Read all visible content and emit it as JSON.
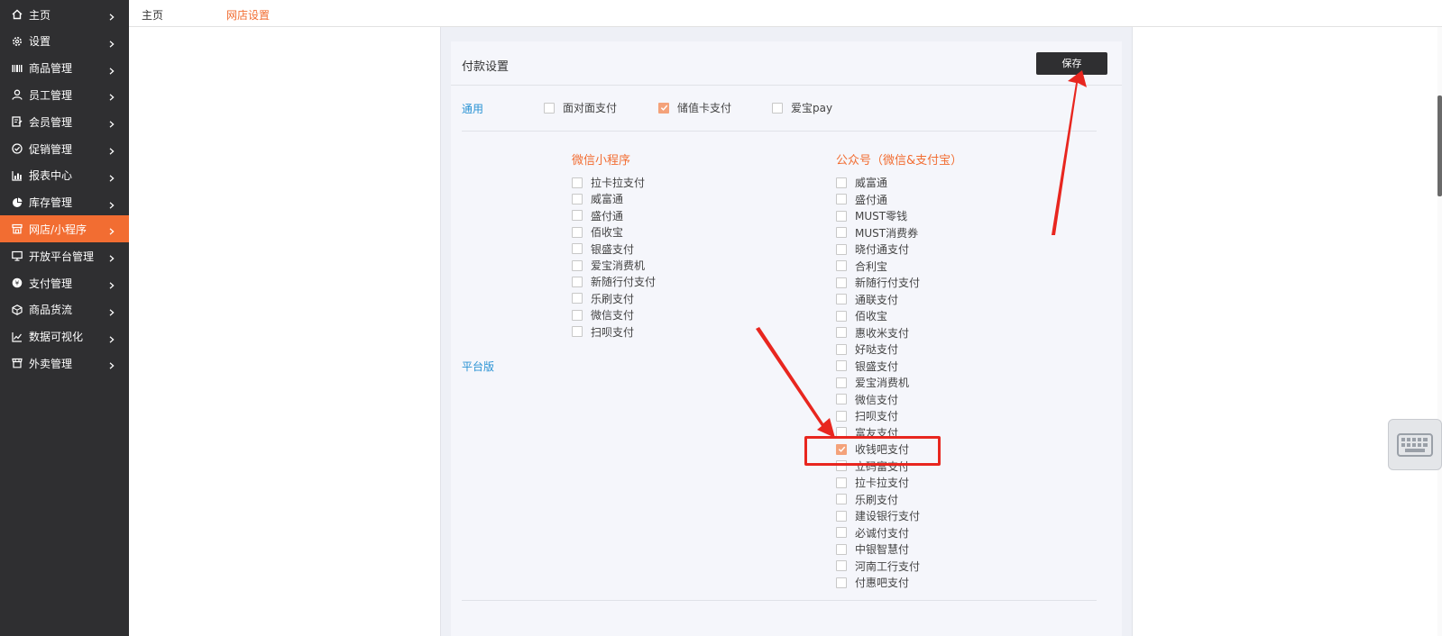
{
  "sidebar": {
    "items": [
      {
        "label": "主页",
        "icon": "home-icon"
      },
      {
        "label": "设置",
        "icon": "gear-icon"
      },
      {
        "label": "商品管理",
        "icon": "barcode-icon"
      },
      {
        "label": "员工管理",
        "icon": "user-icon"
      },
      {
        "label": "会员管理",
        "icon": "member-card-icon"
      },
      {
        "label": "促销管理",
        "icon": "check-circle-icon"
      },
      {
        "label": "报表中心",
        "icon": "bar-chart-icon"
      },
      {
        "label": "库存管理",
        "icon": "pie-chart-icon"
      },
      {
        "label": "网店/小程序",
        "icon": "store-icon"
      },
      {
        "label": "开放平台管理",
        "icon": "monitor-icon"
      },
      {
        "label": "支付管理",
        "icon": "coin-icon"
      },
      {
        "label": "商品货流",
        "icon": "box-icon"
      },
      {
        "label": "数据可视化",
        "icon": "line-chart-icon"
      },
      {
        "label": "外卖管理",
        "icon": "shop-icon"
      }
    ],
    "active_index": 8
  },
  "breadcrumb": {
    "home": "主页",
    "current": "网店设置"
  },
  "panel": {
    "title": "付款设置",
    "save_label": "保存",
    "general": {
      "label": "通用",
      "options": [
        {
          "label": "面对面支付",
          "checked": false
        },
        {
          "label": "储值卡支付",
          "checked": true
        },
        {
          "label": "爱宝pay",
          "checked": false
        }
      ]
    },
    "platform_label": "平台版",
    "mini_program": {
      "title": "微信小程序",
      "options": [
        {
          "label": "拉卡拉支付",
          "checked": false
        },
        {
          "label": "威富通",
          "checked": false
        },
        {
          "label": "盛付通",
          "checked": false
        },
        {
          "label": "佰收宝",
          "checked": false
        },
        {
          "label": "银盛支付",
          "checked": false
        },
        {
          "label": "爱宝消费机",
          "checked": false
        },
        {
          "label": "新随行付支付",
          "checked": false
        },
        {
          "label": "乐刷支付",
          "checked": false
        },
        {
          "label": "微信支付",
          "checked": false
        },
        {
          "label": "扫呗支付",
          "checked": false
        }
      ]
    },
    "official_account": {
      "title": "公众号（微信&支付宝）",
      "options": [
        {
          "label": "威富通",
          "checked": false
        },
        {
          "label": "盛付通",
          "checked": false
        },
        {
          "label": "MUST零钱",
          "checked": false
        },
        {
          "label": "MUST消费券",
          "checked": false
        },
        {
          "label": "晓付通支付",
          "checked": false
        },
        {
          "label": "合利宝",
          "checked": false
        },
        {
          "label": "新随行付支付",
          "checked": false
        },
        {
          "label": "通联支付",
          "checked": false
        },
        {
          "label": "佰收宝",
          "checked": false
        },
        {
          "label": "惠收米支付",
          "checked": false
        },
        {
          "label": "好哒支付",
          "checked": false
        },
        {
          "label": "银盛支付",
          "checked": false
        },
        {
          "label": "爱宝消费机",
          "checked": false
        },
        {
          "label": "微信支付",
          "checked": false
        },
        {
          "label": "扫呗支付",
          "checked": false
        },
        {
          "label": "富友支付",
          "checked": false
        },
        {
          "label": "收钱吧支付",
          "checked": true
        },
        {
          "label": "立码富支付",
          "checked": false
        },
        {
          "label": "拉卡拉支付",
          "checked": false
        },
        {
          "label": "乐刷支付",
          "checked": false
        },
        {
          "label": "建设银行支付",
          "checked": false
        },
        {
          "label": "必诚付支付",
          "checked": false
        },
        {
          "label": "中银智慧付",
          "checked": false
        },
        {
          "label": "河南工行支付",
          "checked": false
        },
        {
          "label": "付惠吧支付",
          "checked": false
        }
      ]
    }
  },
  "colors": {
    "sidebar_bg": "#2f2f31",
    "accent": "#f26d32",
    "link_blue": "#2a93d4",
    "annotation_red": "#e8261f"
  }
}
